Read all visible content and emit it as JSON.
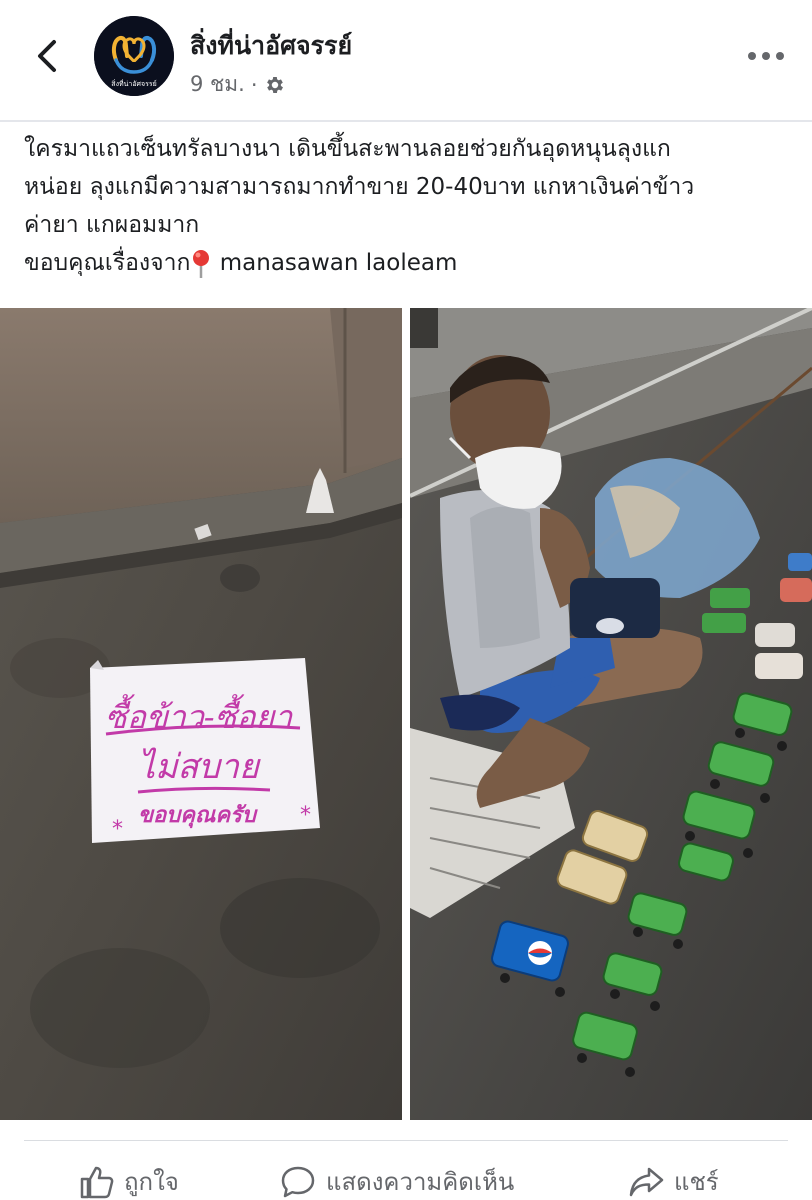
{
  "header": {
    "page_name": "สิ่งที่น่าอัศจรรย์",
    "time": "9 ชม.",
    "separator": "·",
    "avatar_text": "สิ่งที่น่าอัศจรรย์"
  },
  "post": {
    "caption_lines": [
      "ใครมาแถวเซ็นทรัลบางนา เดินขึ้นสะพานลอยช่วยกันอุดหนุนลุงแก",
      "หน่อย ลุงแกมีความสามารถมากทำขาย 20-40บาท แกหาเงินค่าข้าว",
      "ค่ายา แกผอมมาก"
    ],
    "credit_prefix": "ขอบคุณเรื่องจาก",
    "credit_name": "manasawan laoleam"
  },
  "photos": {
    "sign_lines": [
      "ซื้อข้าว-ซื้อยา",
      "ไม่สบาย",
      "ขอบคุณครับ"
    ],
    "sign_asterisk": "*"
  },
  "actions": {
    "like": "ถูกใจ",
    "comment": "แสดงความคิดเห็น",
    "share": "แชร์"
  },
  "colors": {
    "secondary_text": "#65676b",
    "divider": "#e4e6eb",
    "sign_ink": "#c23aa8",
    "sprite_green": "#4caf50",
    "pepsi_blue": "#1565c0"
  },
  "icons": [
    "back-arrow-icon",
    "gear-icon",
    "more-dots-icon",
    "map-pin-icon",
    "thumbs-up-icon",
    "comment-icon",
    "share-icon"
  ]
}
